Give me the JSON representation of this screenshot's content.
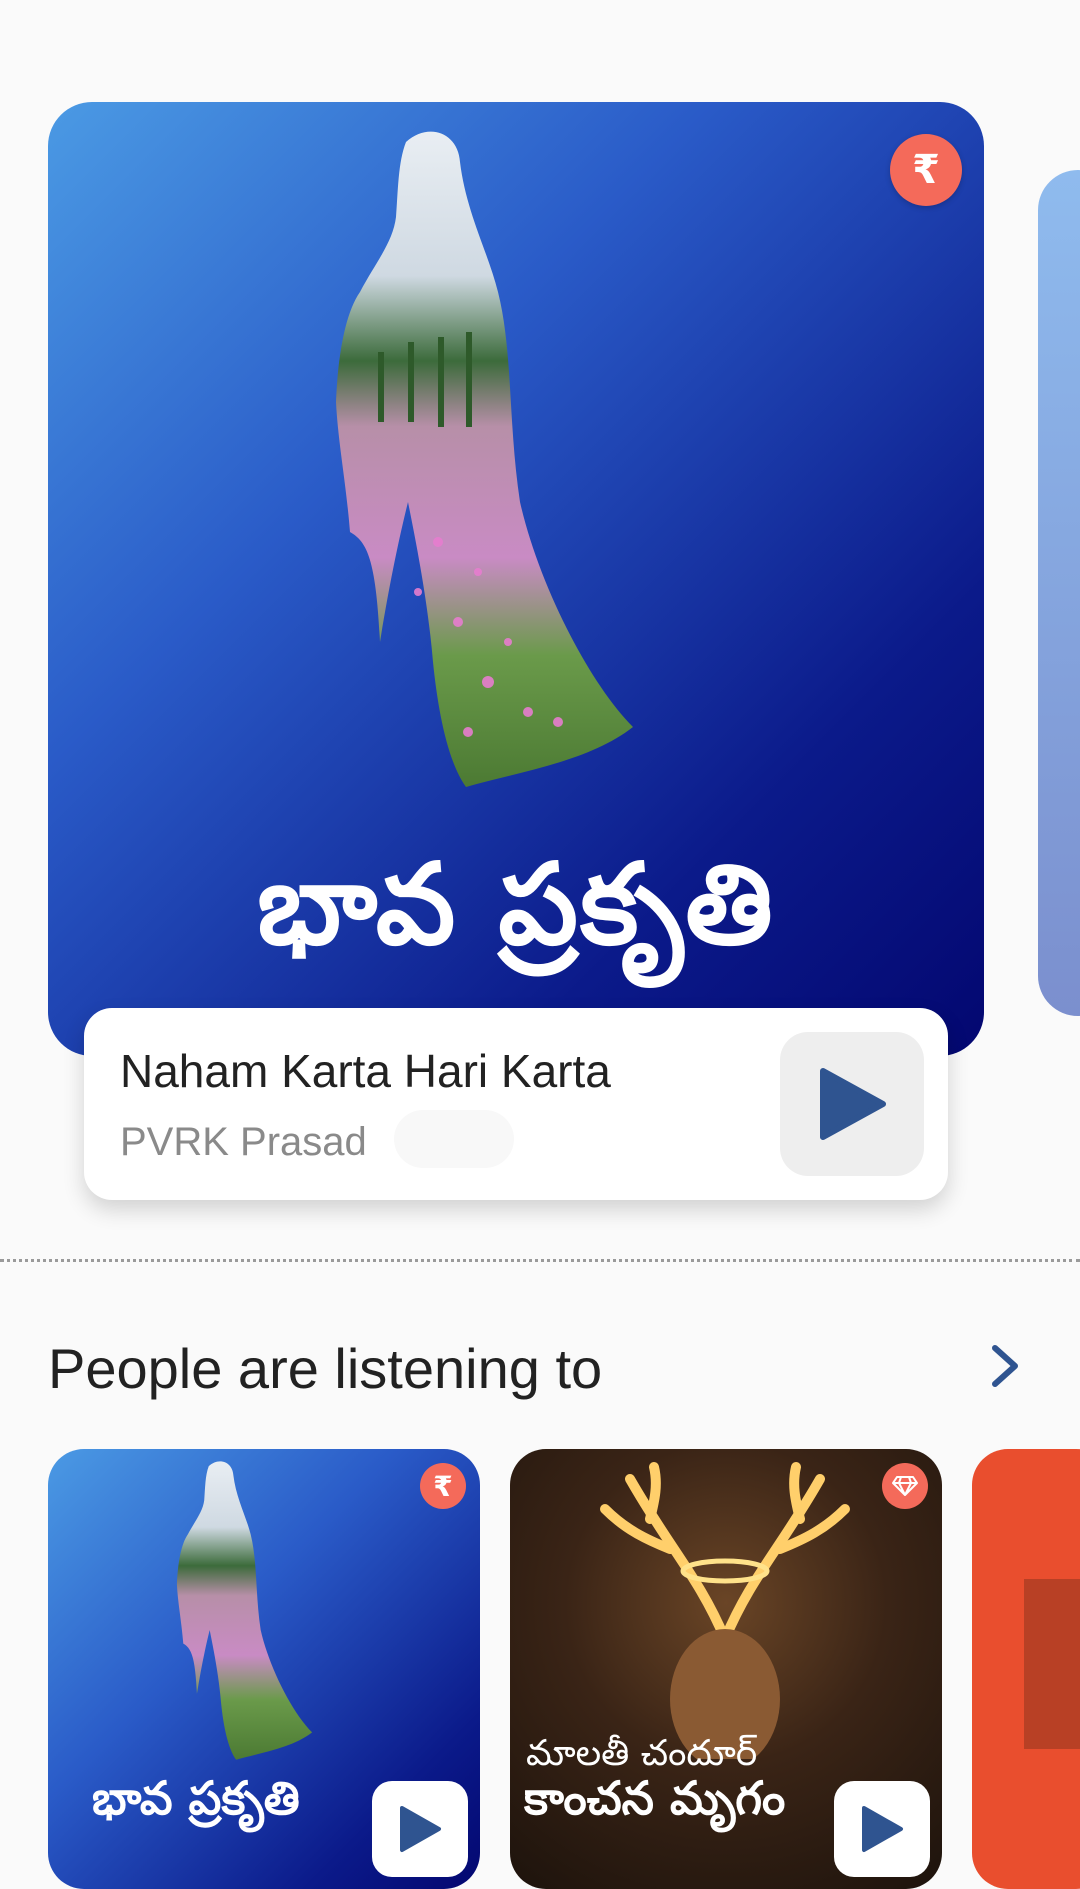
{
  "featured": {
    "cover_title": "భావ ప్రకృతి",
    "badge_symbol": "₹",
    "title": "Naham Karta Hari Karta",
    "author": "PVRK Prasad"
  },
  "section": {
    "title": "People are listening to"
  },
  "cards": [
    {
      "cover_title": "భావ ప్రకృతి",
      "badge_symbol": "₹"
    },
    {
      "cover_subtitle": "మాలతీ చందూర్",
      "cover_title": "కాంచన మృగం",
      "badge_icon": "diamond-icon"
    }
  ],
  "colors": {
    "accent": "#2f5490",
    "badge": "#f46a5a",
    "card3": "#e94e2e"
  }
}
